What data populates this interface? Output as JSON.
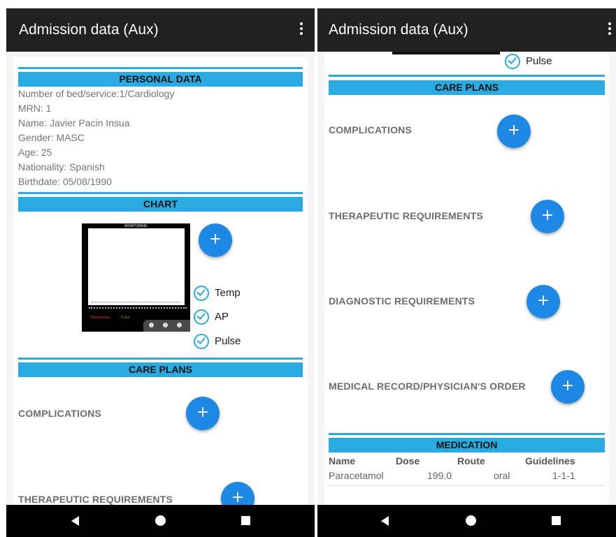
{
  "app": {
    "title": "Admission data (Aux)"
  },
  "personal_data": {
    "header": "PERSONAL DATA",
    "lines": [
      "Number of bed/service:1/Cardiology",
      "MRN: 1",
      "Name: Javier Pacin Insua",
      "Gender: MASC",
      "Age: 25",
      "Nationality: Spanish",
      "Birthdate: 05/08/1990"
    ]
  },
  "chart_section": {
    "header": "CHART",
    "thumbnail": {
      "title": "MONITORING",
      "legend": [
        "Temperature",
        "Pulse"
      ]
    },
    "toggles": [
      "Temp",
      "AP",
      "Pulse"
    ]
  },
  "care_plans": {
    "header": "CARE PLANS",
    "items": [
      "COMPLICATIONS",
      "THERAPEUTIC REQUIREMENTS",
      "DIAGNOSTIC REQUIREMENTS",
      "MEDICAL RECORD/PHYSICIAN'S ORDER"
    ]
  },
  "medication": {
    "header": "MEDICATION",
    "columns": [
      "Name",
      "Dose",
      "Route",
      "Guidelines"
    ],
    "rows": [
      [
        "Paracetamol",
        "199.0",
        "oral",
        "1-1-1"
      ]
    ]
  },
  "fab_symbol": "+",
  "colors": {
    "app_bar": "#212121",
    "section_header": "#29aae1",
    "fab": "#1e88e5",
    "nav_bar": "#000000"
  }
}
